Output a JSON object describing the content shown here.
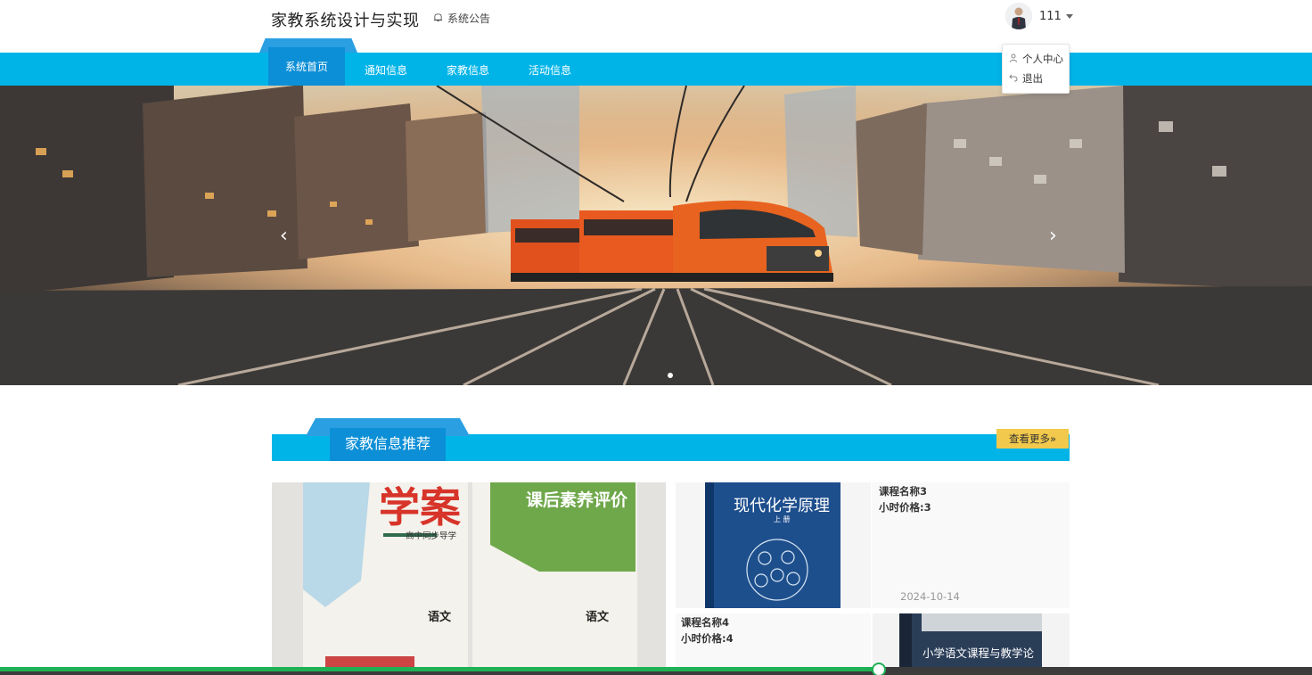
{
  "header": {
    "site_title": "家教系统设计与实现",
    "notice_label": "系统公告",
    "username": "111"
  },
  "user_menu": {
    "items": [
      "个人中心",
      "退出"
    ]
  },
  "nav": {
    "active": "系统首页",
    "items": [
      "通知信息",
      "家教信息",
      "活动信息"
    ]
  },
  "banner": {
    "prev": "‹",
    "next": "›",
    "slide_count": 1,
    "active_slide": 1
  },
  "section": {
    "title": "家教信息推荐",
    "more": "查看更多»"
  },
  "cards": [
    {
      "book_title": "学案",
      "book_sub": "高中同步导学",
      "book_subject": "语文",
      "book2_title": "课后素养评价",
      "book2_subject": "语文"
    },
    {
      "book_title": "现代化学原理",
      "book_sub": "上 册",
      "name": "课程名称3",
      "price": "小时价格:3",
      "date": "2024-10-14"
    },
    {
      "name": "课程名称4",
      "price": "小时价格:4",
      "book_title": "小学语文课程与教学论"
    }
  ],
  "video_progress": 0.67,
  "colors": {
    "nav_bg": "#00b4e8",
    "tab_dark": "#0c8fd6",
    "more_btn": "#f2c94c",
    "progress": "#1fb155"
  }
}
